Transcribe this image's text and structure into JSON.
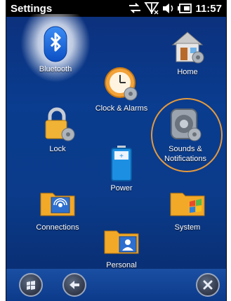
{
  "status": {
    "title": "Settings",
    "time": "11:57",
    "icons": [
      "network-arrows-icon",
      "no-signal-icon",
      "volume-icon",
      "battery-icon"
    ]
  },
  "tiles": [
    {
      "id": "bluetooth",
      "label": "Bluetooth"
    },
    {
      "id": "home",
      "label": "Home"
    },
    {
      "id": "clock",
      "label": "Clock & Alarms"
    },
    {
      "id": "lock",
      "label": "Lock"
    },
    {
      "id": "sounds",
      "label": "Sounds &\nNotifications"
    },
    {
      "id": "power",
      "label": "Power"
    },
    {
      "id": "connections",
      "label": "Connections"
    },
    {
      "id": "system",
      "label": "System"
    },
    {
      "id": "personal",
      "label": "Personal"
    }
  ],
  "bottom": {
    "icons": [
      "windows-start-icon",
      "back-arrow-icon",
      "close-icon"
    ]
  },
  "colors": {
    "accent_circle": "#e59a3c",
    "background": "#0b3b8a"
  }
}
